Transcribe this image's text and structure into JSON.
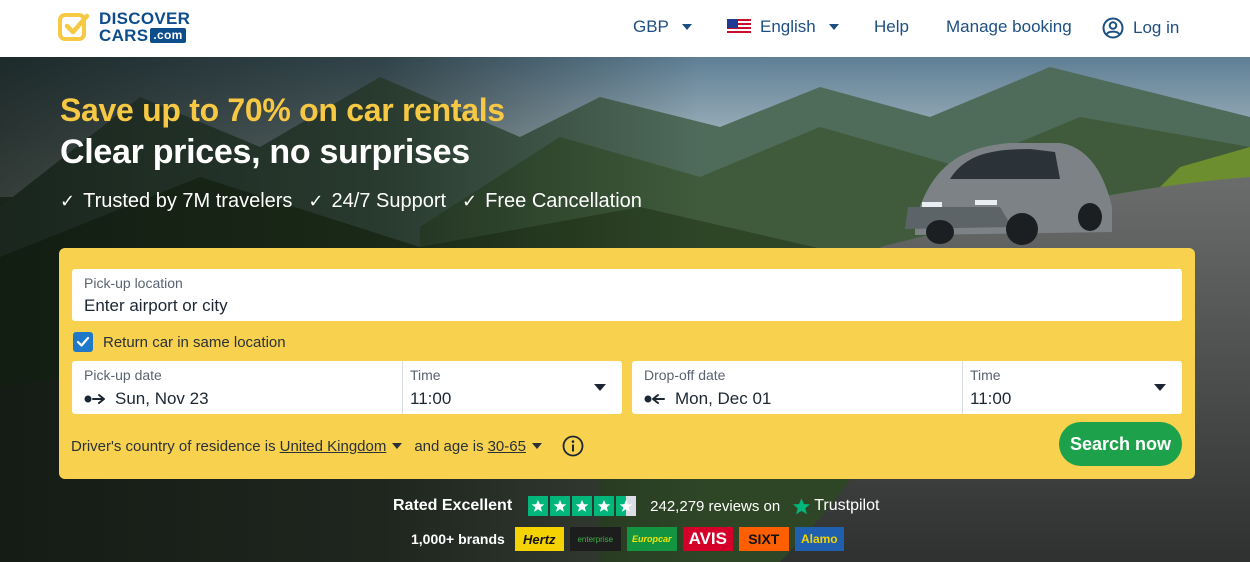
{
  "header": {
    "logo_line1": "DISCOVER",
    "logo_line2": "CARS",
    "logo_dotcom": ".com",
    "currency": "GBP",
    "language": "English",
    "help": "Help",
    "manage_booking": "Manage booking",
    "login": "Log in"
  },
  "hero": {
    "headline1": "Save up to 70% on car rentals",
    "headline2": "Clear prices, no surprises",
    "perks": [
      "Trusted by 7M travelers",
      "24/7 Support",
      "Free Cancellation"
    ]
  },
  "search": {
    "pickup_location_label": "Pick-up location",
    "pickup_location_placeholder": "Enter airport or city",
    "return_same_label": "Return car in same location",
    "return_same_checked": true,
    "pickup_date_label": "Pick-up date",
    "pickup_date_value": "Sun, Nov 23",
    "pickup_time_label": "Time",
    "pickup_time_value": "11:00",
    "dropoff_date_label": "Drop-off date",
    "dropoff_date_value": "Mon, Dec 01",
    "dropoff_time_label": "Time",
    "dropoff_time_value": "11:00",
    "residence_prefix": "Driver's country of residence is",
    "residence_country": "United Kingdom",
    "age_prefix": "and age is",
    "age_value": "30-65",
    "search_button": "Search now"
  },
  "trust": {
    "rated": "Rated Excellent",
    "reviews": "242,279 reviews on",
    "trustpilot": "Trustpilot",
    "rating_stars": 4.5
  },
  "brands": {
    "label": "1,000+ brands",
    "items": [
      {
        "name": "Hertz",
        "bg": "#f5d300",
        "fg": "#111111"
      },
      {
        "name": "enterprise",
        "bg": "#1d1d1d",
        "fg": "#3cb34a"
      },
      {
        "name": "Europcar",
        "bg": "#129441",
        "fg": "#f2e600"
      },
      {
        "name": "AVIS",
        "bg": "#d4002a",
        "fg": "#ffffff"
      },
      {
        "name": "SIXT",
        "bg": "#ff5f00",
        "fg": "#111111"
      },
      {
        "name": "Alamo",
        "bg": "#1f5fae",
        "fg": "#f5d300"
      }
    ]
  },
  "colors": {
    "brand_blue": "#0e4d8c",
    "accent_yellow": "#f8d24e",
    "headline_yellow": "#f6c844",
    "cta_green": "#1ea14b",
    "trustpilot_green": "#00b67a"
  }
}
